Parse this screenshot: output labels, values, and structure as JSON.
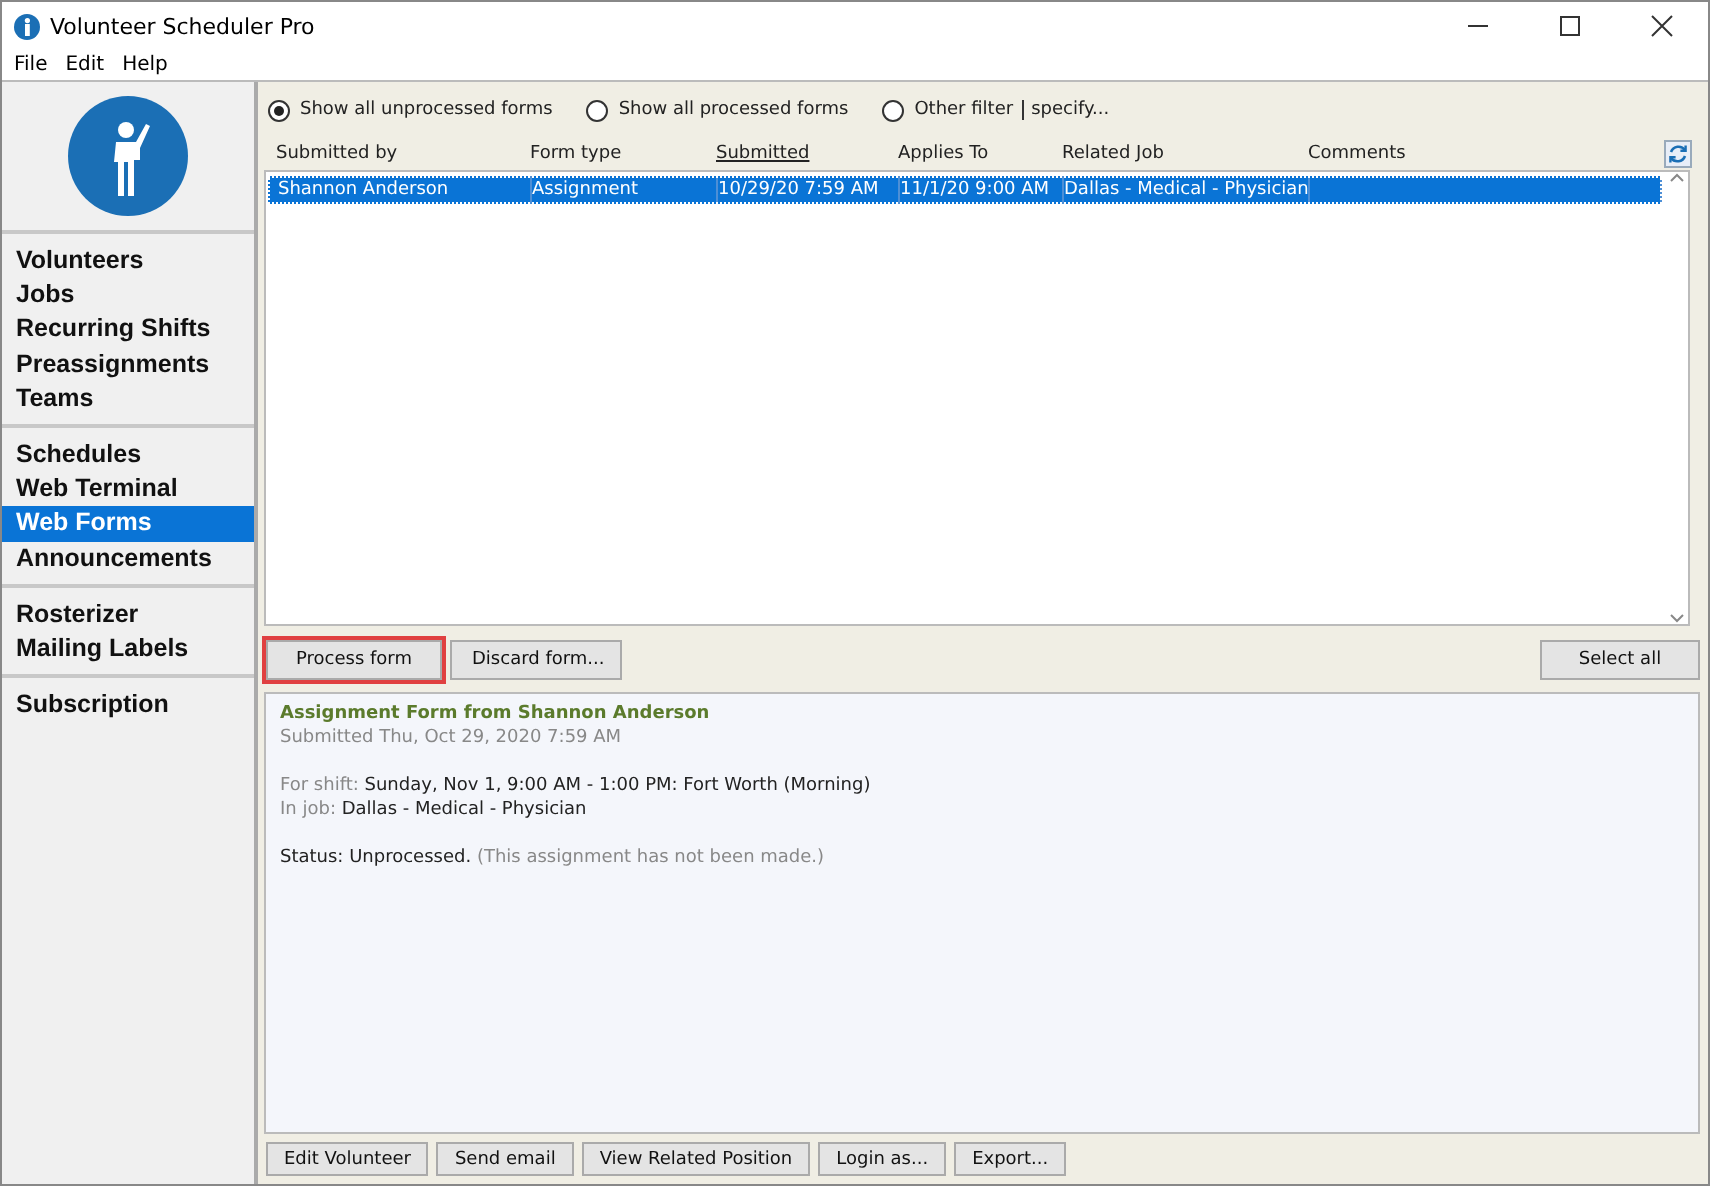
{
  "window": {
    "title": "Volunteer Scheduler Pro"
  },
  "menu": [
    "File",
    "Edit",
    "Help"
  ],
  "sidebar": {
    "groups": [
      {
        "items": [
          {
            "label": "Volunteers",
            "selected": false
          },
          {
            "label": "Jobs",
            "selected": false
          },
          {
            "label": "Recurring Shifts",
            "selected": false
          },
          {
            "label": "Preassignments",
            "selected": false
          },
          {
            "label": "Teams",
            "selected": false
          }
        ]
      },
      {
        "items": [
          {
            "label": "Schedules",
            "selected": false
          },
          {
            "label": "Web Terminal",
            "selected": false
          },
          {
            "label": "Web Forms",
            "selected": true
          },
          {
            "label": "Announcements",
            "selected": false
          }
        ]
      },
      {
        "items": [
          {
            "label": "Rosterizer",
            "selected": false
          },
          {
            "label": "Mailing Labels",
            "selected": false
          }
        ]
      },
      {
        "items": [
          {
            "label": "Subscription",
            "selected": false
          }
        ]
      }
    ]
  },
  "filters": [
    {
      "label": "Show all unprocessed forms",
      "selected": true
    },
    {
      "label": "Show all processed forms",
      "selected": false
    },
    {
      "label": "Other filter",
      "selected": false,
      "link": "specify..."
    }
  ],
  "table": {
    "columns": [
      {
        "label": "Submitted by",
        "sorted": false
      },
      {
        "label": "Form type",
        "sorted": false
      },
      {
        "label": "Submitted",
        "sorted": true
      },
      {
        "label": "Applies To",
        "sorted": false
      },
      {
        "label": "Related Job",
        "sorted": false
      },
      {
        "label": "Comments",
        "sorted": false
      }
    ],
    "rows": [
      {
        "selected": true,
        "cells": [
          "Shannon Anderson",
          "Assignment",
          "10/29/20  7:59 AM",
          "11/1/20  9:00 AM",
          "Dallas - Medical - Physician",
          ""
        ]
      }
    ]
  },
  "actions": [
    {
      "label": "Process form",
      "highlighted": true
    },
    {
      "label": "Discard form...",
      "highlighted": false
    }
  ],
  "select_all": "Select all",
  "detail": {
    "heading": "Assignment Form from Shannon Anderson",
    "submitted": "Submitted Thu, Oct 29, 2020 7:59 AM",
    "fields": [
      {
        "label": "For shift:",
        "value": "Sunday, Nov 1, 9:00 AM - 1:00 PM: Fort Worth (Morning)"
      },
      {
        "label": "In job:",
        "value": "Dallas - Medical - Physician"
      }
    ],
    "status": "Status: Unprocessed.",
    "status_note": "(This assignment has not been made.)"
  },
  "bottom_buttons": [
    "Edit Volunteer",
    "Send email",
    "View Related Position",
    "Login as...",
    "Export..."
  ]
}
